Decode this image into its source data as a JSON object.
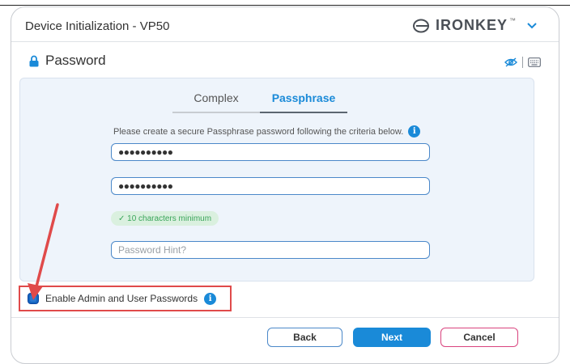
{
  "window": {
    "title": "Device Initialization - VP50",
    "brand": "IRONKEY",
    "brand_tm": "™"
  },
  "section": {
    "title": "Password"
  },
  "tabs": [
    {
      "label": "Complex",
      "active": false
    },
    {
      "label": "Passphrase",
      "active": true
    }
  ],
  "instructions": "Please create a secure Passphrase password following the criteria below.",
  "fields": {
    "password_value": "●●●●●●●●●●",
    "confirm_value": "●●●●●●●●●●",
    "hint_placeholder": "Password Hint?"
  },
  "criteria": {
    "text": "✓ 10 characters minimum"
  },
  "admin": {
    "label": "Enable Admin and User Passwords",
    "checked": true
  },
  "buttons": {
    "back": "Back",
    "next": "Next",
    "cancel": "Cancel"
  },
  "colors": {
    "accent": "#1a8ad8",
    "highlight_box": "#e04a4a",
    "cancel_border": "#d9437e",
    "criteria_ok": "#3aa55a"
  }
}
